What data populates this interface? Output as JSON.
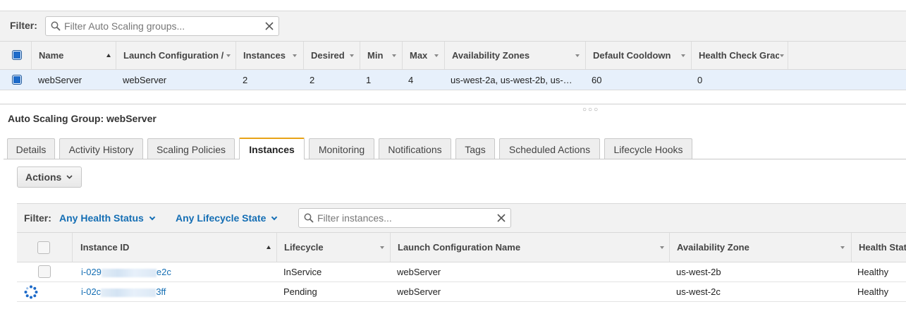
{
  "top_filter": {
    "label": "Filter:",
    "placeholder": "Filter Auto Scaling groups..."
  },
  "asg_table": {
    "columns": [
      {
        "label": "Name",
        "sort": "asc"
      },
      {
        "label": "Launch Configuration /"
      },
      {
        "label": "Instances"
      },
      {
        "label": "Desired"
      },
      {
        "label": "Min"
      },
      {
        "label": "Max"
      },
      {
        "label": "Availability Zones"
      },
      {
        "label": "Default Cooldown"
      },
      {
        "label": "Health Check Grac"
      }
    ],
    "rows": [
      {
        "selected": true,
        "name": "webServer",
        "launch_config": "webServer",
        "instances": "2",
        "desired": "2",
        "min": "1",
        "max": "4",
        "azs": "us-west-2a, us-west-2b, us-…",
        "cooldown": "60",
        "health_grace": "0"
      }
    ]
  },
  "detail": {
    "title": "Auto Scaling Group: webServer",
    "tabs": [
      "Details",
      "Activity History",
      "Scaling Policies",
      "Instances",
      "Monitoring",
      "Notifications",
      "Tags",
      "Scheduled Actions",
      "Lifecycle Hooks"
    ],
    "active_tab": "Instances",
    "actions_label": "Actions"
  },
  "instances_filter": {
    "label": "Filter:",
    "health_status": "Any Health Status",
    "lifecycle_state": "Any Lifecycle State",
    "placeholder": "Filter instances..."
  },
  "instances_table": {
    "columns": [
      "Instance ID",
      "Lifecycle",
      "Launch Configuration Name",
      "Availability Zone",
      "Health Stat"
    ],
    "rows": [
      {
        "id_prefix": "i-029",
        "id_suffix": "e2c",
        "lifecycle": "InService",
        "launch_config": "webServer",
        "az": "us-west-2b",
        "health": "Healthy",
        "state_icon": "checkbox"
      },
      {
        "id_prefix": "i-02c",
        "id_suffix": "3ff",
        "lifecycle": "Pending",
        "launch_config": "webServer",
        "az": "us-west-2c",
        "health": "Healthy",
        "state_icon": "spinner-icon"
      }
    ]
  },
  "colors": {
    "accent_link": "#146eb4",
    "active_tab_border": "#e8a317",
    "selected_row": "#e7f0fb"
  }
}
